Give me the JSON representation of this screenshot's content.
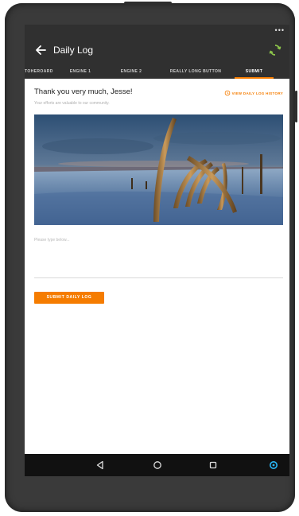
{
  "status_bar": {
    "indicator": "•••"
  },
  "app_bar": {
    "title": "Daily Log",
    "back_icon": "arrow-left-icon",
    "sync_icon": "sync-icon"
  },
  "tabs": [
    {
      "label": "TOHEROARD",
      "active": false
    },
    {
      "label": "ENGINE 1",
      "active": false
    },
    {
      "label": "ENGINE 2",
      "active": false
    },
    {
      "label": "REALLY LONG BUTTON",
      "active": false
    },
    {
      "label": "SUBMIT",
      "active": true
    }
  ],
  "content": {
    "thanks_text": "Thank you very much, Jesse!",
    "subtext": "Your efforts are valuable to our community.",
    "history_link": "VIEW DAILY LOG HISTORY",
    "notes_placeholder": "Please type below...",
    "submit_label": "SUBMIT DAILY LOG"
  },
  "nav_bar": {
    "back": "triangle-back-icon",
    "home": "circle-home-icon",
    "recents": "square-recents-icon",
    "assistant": "assistant-icon"
  },
  "colors": {
    "accent": "#f57c00",
    "app_bar": "#303030",
    "nav_bar": "#111111"
  }
}
